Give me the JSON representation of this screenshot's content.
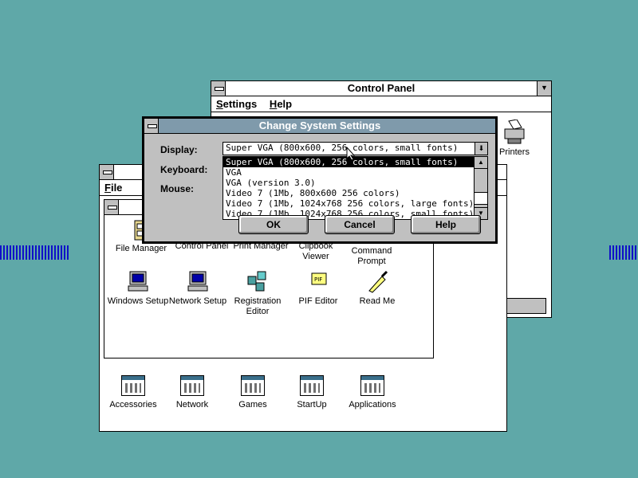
{
  "control_panel": {
    "title": "Control Panel",
    "menu": [
      "Settings",
      "Help"
    ],
    "printers_label": "Printers"
  },
  "program_manager": {
    "menu_file": "File",
    "main_icons": [
      "File Manager",
      "Control Panel",
      "Print Manager",
      "Clipbook Viewer",
      "Command Prompt",
      "Windows Setup",
      "Network Setup",
      "Registration Editor",
      "PIF Editor",
      "Read Me"
    ],
    "groups": [
      "Accessories",
      "Network",
      "Games",
      "StartUp",
      "Applications"
    ]
  },
  "dialog": {
    "title": "Change System Settings",
    "display_label": "Display:",
    "keyboard_label": "Keyboard:",
    "mouse_label": "Mouse:",
    "display_value": "Super VGA (800x600, 256 colors, small fonts)",
    "display_options": [
      "Super VGA (800x600, 256 colors, small fonts)",
      "VGA",
      "VGA (version 3.0)",
      "Video 7 (1Mb,  800x600 256 colors)",
      "Video 7 (1Mb, 1024x768 256 colors, large fonts)",
      "Video 7 (1Mb, 1024x768 256 colors, small fonts)"
    ],
    "ok_label": "OK",
    "cancel_label": "Cancel",
    "help_label": "Help"
  },
  "colors": {
    "desktop": "#5fa8a8",
    "active_title": "#7f9aab"
  }
}
